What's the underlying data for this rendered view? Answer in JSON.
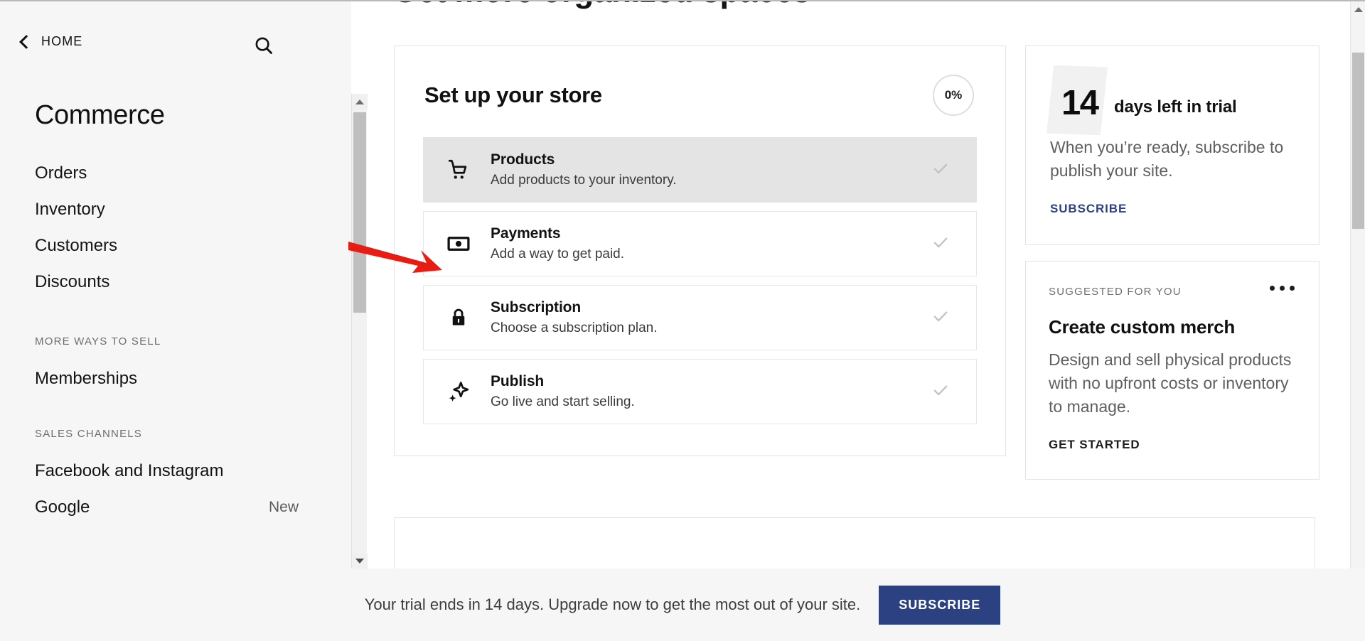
{
  "left_panel": {
    "back_label": "HOME",
    "back_icon": "chevron-left-icon",
    "search_icon": "search-icon",
    "title": "Commerce",
    "nav_items": [
      {
        "label": "Orders",
        "badge": ""
      },
      {
        "label": "Inventory",
        "badge": ""
      },
      {
        "label": "Customers",
        "badge": ""
      },
      {
        "label": "Discounts",
        "badge": ""
      }
    ],
    "section_more": "MORE WAYS TO SELL",
    "more_items": [
      {
        "label": "Memberships",
        "badge": ""
      }
    ],
    "section_channels": "SALES CHANNELS",
    "channel_items": [
      {
        "label": "Facebook and Instagram",
        "badge": ""
      },
      {
        "label": "Google",
        "badge": "New"
      }
    ]
  },
  "main": {
    "cut_heading": "Get more organized spaces",
    "setup": {
      "title": "Set up your store",
      "progress": "0%",
      "tasks": [
        {
          "name": "Products",
          "desc": "Add products to your inventory.",
          "icon": "shopping-cart-icon",
          "state": "active"
        },
        {
          "name": "Payments",
          "desc": "Add a way to get paid.",
          "icon": "banknote-icon",
          "state": "default"
        },
        {
          "name": "Subscription",
          "desc": "Choose a subscription plan.",
          "icon": "lock-icon",
          "state": "default"
        },
        {
          "name": "Publish",
          "desc": "Go live and start selling.",
          "icon": "sparkle-icon",
          "state": "default"
        }
      ]
    },
    "trial_card": {
      "days": "14",
      "days_label": "days left in trial",
      "body": "When you’re ready, subscribe to publish your site.",
      "action": "SUBSCRIBE"
    },
    "suggested_card": {
      "kicker": "SUGGESTED FOR YOU",
      "menu_icon": "ellipsis-icon",
      "title": "Create custom merch",
      "body": "Design and sell physical products with no upfront costs or inventory to manage.",
      "action": "GET STARTED"
    }
  },
  "banner": {
    "text": "Your trial ends in 14 days. Upgrade now to get the most out of your site.",
    "button": "SUBSCRIBE"
  },
  "annotation": {
    "arrow_icon": "red-pointer-arrow",
    "color": "#e81c13"
  },
  "colors": {
    "accent_blue": "#2c4182",
    "panel_bg": "#f6f6f6",
    "active_row": "#e4e4e4",
    "check_gray": "#c4c4c4"
  }
}
